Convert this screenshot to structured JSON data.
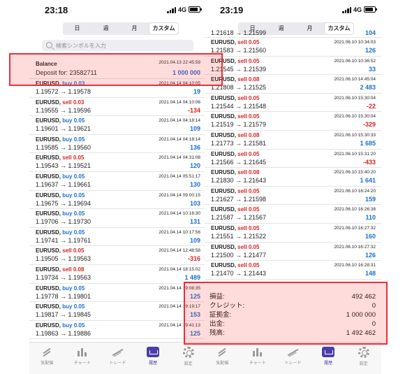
{
  "left": {
    "status": {
      "time": "23:18",
      "network": "4G"
    },
    "segments": [
      {
        "label": "日",
        "active": false
      },
      {
        "label": "週",
        "active": false
      },
      {
        "label": "月",
        "active": false
      },
      {
        "label": "カスタム",
        "active": true
      }
    ],
    "search_placeholder": "検索シンボルを入力",
    "balance": {
      "title": "Balance",
      "deposit": "Deposit for: 23582711",
      "datetime": "2021.04.13 22:45:59",
      "amount": "1 000 000"
    },
    "rows": [
      {
        "symbol": "EURUSD,",
        "dir": "buy 0.03",
        "side": "buy",
        "prices": "1.19572 → 1.19578",
        "datetime": "2021.04.14 04:10:05",
        "pl": "19",
        "sign": "pos"
      },
      {
        "symbol": "EURUSD,",
        "dir": "sell 0.03",
        "side": "sell",
        "prices": "1.19555 → 1.19596",
        "datetime": "2021.04.14 04:10:06",
        "pl": "-134",
        "sign": "neg"
      },
      {
        "symbol": "EURUSD,",
        "dir": "buy 0.05",
        "side": "buy",
        "prices": "1.19601 → 1.19621",
        "datetime": "2021.04.14 04:18:14",
        "pl": "109",
        "sign": "pos"
      },
      {
        "symbol": "EURUSD,",
        "dir": "buy 0.05",
        "side": "buy",
        "prices": "1.19585 → 1.19560",
        "datetime": "2021.04.14 04:18:14",
        "pl": "136",
        "sign": "pos"
      },
      {
        "symbol": "EURUSD,",
        "dir": "sell 0.05",
        "side": "sell",
        "prices": "1.19543 → 1.19521",
        "datetime": "2021.04.14 04:31:08",
        "pl": "120",
        "sign": "pos"
      },
      {
        "symbol": "EURUSD,",
        "dir": "buy 0.05",
        "side": "buy",
        "prices": "1.19637 → 1.19661",
        "datetime": "2021.04.14 05:51:17",
        "pl": "130",
        "sign": "pos"
      },
      {
        "symbol": "EURUSD,",
        "dir": "buy 0.05",
        "side": "buy",
        "prices": "1.19675 → 1.19694",
        "datetime": "2021.04.14 09:00:15",
        "pl": "103",
        "sign": "pos"
      },
      {
        "symbol": "EURUSD,",
        "dir": "buy 0.05",
        "side": "buy",
        "prices": "1.19706 → 1.19730",
        "datetime": "2021.04.14 10:16:30",
        "pl": "131",
        "sign": "pos"
      },
      {
        "symbol": "EURUSD,",
        "dir": "buy 0.05",
        "side": "buy",
        "prices": "1.19741 → 1.19761",
        "datetime": "2021.04.14 10:17:56",
        "pl": "109",
        "sign": "pos"
      },
      {
        "symbol": "EURUSD,",
        "dir": "sell 0.05",
        "side": "sell",
        "prices": "1.19505 → 1.19563",
        "datetime": "2021.04.14 12:48:58",
        "pl": "-316",
        "sign": "neg"
      },
      {
        "symbol": "EURUSD,",
        "dir": "sell 0.08",
        "side": "sell",
        "prices": "1.19734 → 1.19563",
        "datetime": "2021.04.14 18:15:02",
        "pl": "1 489",
        "sign": "pos"
      },
      {
        "symbol": "EURUSD,",
        "dir": "buy 0.05",
        "side": "buy",
        "prices": "1.19778 → 1.19801",
        "datetime": "2021.04.14 19:08:35",
        "pl": "125",
        "sign": "pos"
      },
      {
        "symbol": "EURUSD,",
        "dir": "buy 0.05",
        "side": "buy",
        "prices": "1.19817 → 1.19845",
        "datetime": "2021.04.14 19:19:17",
        "pl": "153",
        "sign": "pos"
      },
      {
        "symbol": "EURUSD,",
        "dir": "buy 0.05",
        "side": "buy",
        "prices": "1.19863 → 1.19886",
        "datetime": "2021.04.14 19:41:13",
        "pl": "125",
        "sign": "pos"
      }
    ]
  },
  "right": {
    "status": {
      "time": "23:19",
      "network": "4G"
    },
    "segments": [
      {
        "label": "日",
        "active": false
      },
      {
        "label": "週",
        "active": false
      },
      {
        "label": "月",
        "active": false
      },
      {
        "label": "カスタム",
        "active": true
      }
    ],
    "partial_top": {
      "prices": "1.21618 → 1.21599",
      "pl": "104"
    },
    "rows": [
      {
        "symbol": "EURUSD,",
        "dir": "sell 0.05",
        "side": "sell",
        "prices": "1.21583 → 1.21560",
        "datetime": "2021.06.10 10:34:03",
        "pl": "126",
        "sign": "pos"
      },
      {
        "symbol": "EURUSD,",
        "dir": "sell 0.05",
        "side": "sell",
        "prices": "1.21545 → 1.21539",
        "datetime": "2021.06.10 10:36:52",
        "pl": "33",
        "sign": "pos"
      },
      {
        "symbol": "EURUSD,",
        "dir": "sell 0.08",
        "side": "sell",
        "prices": "1.21808 → 1.21525",
        "datetime": "2021.06.10 14:45:04",
        "pl": "2 483",
        "sign": "pos"
      },
      {
        "symbol": "EURUSD,",
        "dir": "sell 0.05",
        "side": "sell",
        "prices": "1.21544 → 1.21548",
        "datetime": "2021.06.10 15:30:04",
        "pl": "-22",
        "sign": "neg"
      },
      {
        "symbol": "EURUSD,",
        "dir": "sell 0.05",
        "side": "sell",
        "prices": "1.21519 → 1.21579",
        "datetime": "2021.06.10 15:30:04",
        "pl": "-329",
        "sign": "neg"
      },
      {
        "symbol": "EURUSD,",
        "dir": "sell 0.08",
        "side": "sell",
        "prices": "1.21773 → 1.21581",
        "datetime": "2021.06.10 15:30:33",
        "pl": "1 685",
        "sign": "pos"
      },
      {
        "symbol": "EURUSD,",
        "dir": "sell 0.05",
        "side": "sell",
        "prices": "1.21566 → 1.21645",
        "datetime": "2021.06.10 15:31:20",
        "pl": "-433",
        "sign": "neg"
      },
      {
        "symbol": "EURUSD,",
        "dir": "sell 0.08",
        "side": "sell",
        "prices": "1.21830 → 1.21643",
        "datetime": "2021.06.10 15:40:20",
        "pl": "1 641",
        "sign": "pos"
      },
      {
        "symbol": "EURUSD,",
        "dir": "sell 0.05",
        "side": "sell",
        "prices": "1.21627 → 1.21598",
        "datetime": "2021.06.10 16:24:20",
        "pl": "159",
        "sign": "pos"
      },
      {
        "symbol": "EURUSD,",
        "dir": "sell 0.05",
        "side": "sell",
        "prices": "1.21587 → 1.21567",
        "datetime": "2021.06.10 16:26:38",
        "pl": "110",
        "sign": "pos"
      },
      {
        "symbol": "EURUSD,",
        "dir": "sell 0.05",
        "side": "sell",
        "prices": "1.21551 → 1.21522",
        "datetime": "2021.06.10 16:27:32",
        "pl": "160",
        "sign": "pos"
      },
      {
        "symbol": "EURUSD,",
        "dir": "sell 0.05",
        "side": "sell",
        "prices": "1.21500 → 1.21477",
        "datetime": "2021.06.10 16:27:32",
        "pl": "126",
        "sign": "pos"
      },
      {
        "symbol": "EURUSD,",
        "dir": "sell 0.05",
        "side": "sell",
        "prices": "1.21470 → 1.21443",
        "datetime": "2021.06.10 16:28:31",
        "pl": "148",
        "sign": "pos"
      }
    ],
    "summary": [
      {
        "label": "損益:",
        "value": "492 462"
      },
      {
        "label": "クレジット:",
        "value": "0"
      },
      {
        "label": "証拠金:",
        "value": "1 000 000"
      },
      {
        "label": "出金:",
        "value": "0"
      },
      {
        "label": "残高:",
        "value": "1 492 462"
      }
    ]
  },
  "tabs": [
    {
      "label": "気配値",
      "icon": "quotes-icon",
      "active": false
    },
    {
      "label": "チャート",
      "icon": "chart-icon",
      "active": false
    },
    {
      "label": "トレード",
      "icon": "trade-icon",
      "active": false
    },
    {
      "label": "履歴",
      "icon": "history-icon",
      "active": true
    },
    {
      "label": "設定",
      "icon": "settings-icon",
      "active": false
    }
  ],
  "colors": {
    "buy": "#1a6fd0",
    "sell": "#dd2222",
    "accent": "#4a3ea8",
    "highlight": "#e8303a"
  }
}
